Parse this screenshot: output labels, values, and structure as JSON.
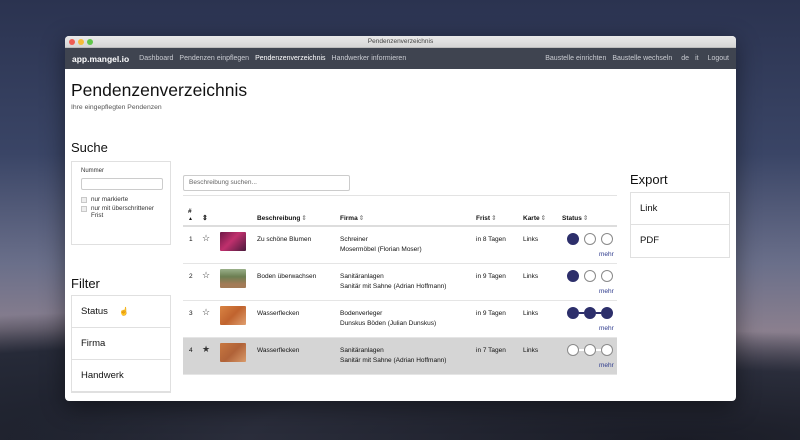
{
  "window": {
    "title": "Pendenzenverzeichnis"
  },
  "nav": {
    "brand": "app.mangel.io",
    "links": [
      "Dashboard",
      "Pendenzen einpflegen",
      "Pendenzenverzeichnis",
      "Handwerker informieren"
    ],
    "right_links": [
      "Baustelle einrichten",
      "Baustelle wechseln",
      "de",
      "it",
      "Logout"
    ],
    "active_link": "Pendenzenverzeichnis"
  },
  "page": {
    "title": "Pendenzenverzeichnis",
    "subtitle": "Ihre eingepflegten Pendenzen"
  },
  "search": {
    "heading": "Suche",
    "number_label": "Nummer",
    "number_value": "",
    "checkboxes": [
      "nur markierte",
      "nur mit überschrittener Frist"
    ]
  },
  "filter": {
    "heading": "Filter",
    "items": [
      "Status",
      "Firma",
      "Handwerk"
    ]
  },
  "export": {
    "heading": "Export",
    "items": [
      "Link",
      "PDF"
    ]
  },
  "table": {
    "search_placeholder": "Beschreibung suchen...",
    "headers": {
      "number": "#",
      "number_sort_icon": "caret-up-icon",
      "mark_sort_icon": "sort-icon",
      "description": "Beschreibung",
      "company": "Firma",
      "deadline": "Frist",
      "map": "Karte",
      "status": "Status"
    },
    "rows": [
      {
        "number": "1",
        "starred": false,
        "thumb": "flowers",
        "description": "Zu schöne Blumen",
        "trade": "Schreiner",
        "company": "Mosermöbel (Florian Moser)",
        "deadline": "in 8 Tagen",
        "map": "Links",
        "status": [
          true,
          false,
          false
        ],
        "more": "mehr"
      },
      {
        "number": "2",
        "starred": false,
        "thumb": "landscape",
        "description": "Boden überwachsen",
        "trade": "Sanitäranlagen",
        "company": "Sanitär mit Sahne (Adrian Hoffmann)",
        "deadline": "in 9 Tagen",
        "map": "Links",
        "status": [
          true,
          false,
          false
        ],
        "more": "mehr"
      },
      {
        "number": "3",
        "starred": false,
        "thumb": "stain",
        "description": "Wasserflecken",
        "trade": "Bodenverleger",
        "company": "Dunskus Böden (Julian Dunskus)",
        "deadline": "in 9 Tagen",
        "map": "Links",
        "status": [
          true,
          true,
          true
        ],
        "more": "mehr"
      },
      {
        "number": "4",
        "starred": true,
        "thumb": "stain",
        "description": "Wasserflecken",
        "trade": "Sanitäranlagen",
        "company": "Sanitär mit Sahne (Adrian Hoffmann)",
        "deadline": "in 7 Tagen",
        "map": "Links",
        "status": [
          false,
          false,
          false
        ],
        "more": "mehr",
        "highlighted": true
      }
    ]
  },
  "colors": {
    "navbar": "#3f4450",
    "status_active": "#2d2f6b",
    "row_highlight": "#d5d5d5",
    "link": "#2d3a8c"
  }
}
